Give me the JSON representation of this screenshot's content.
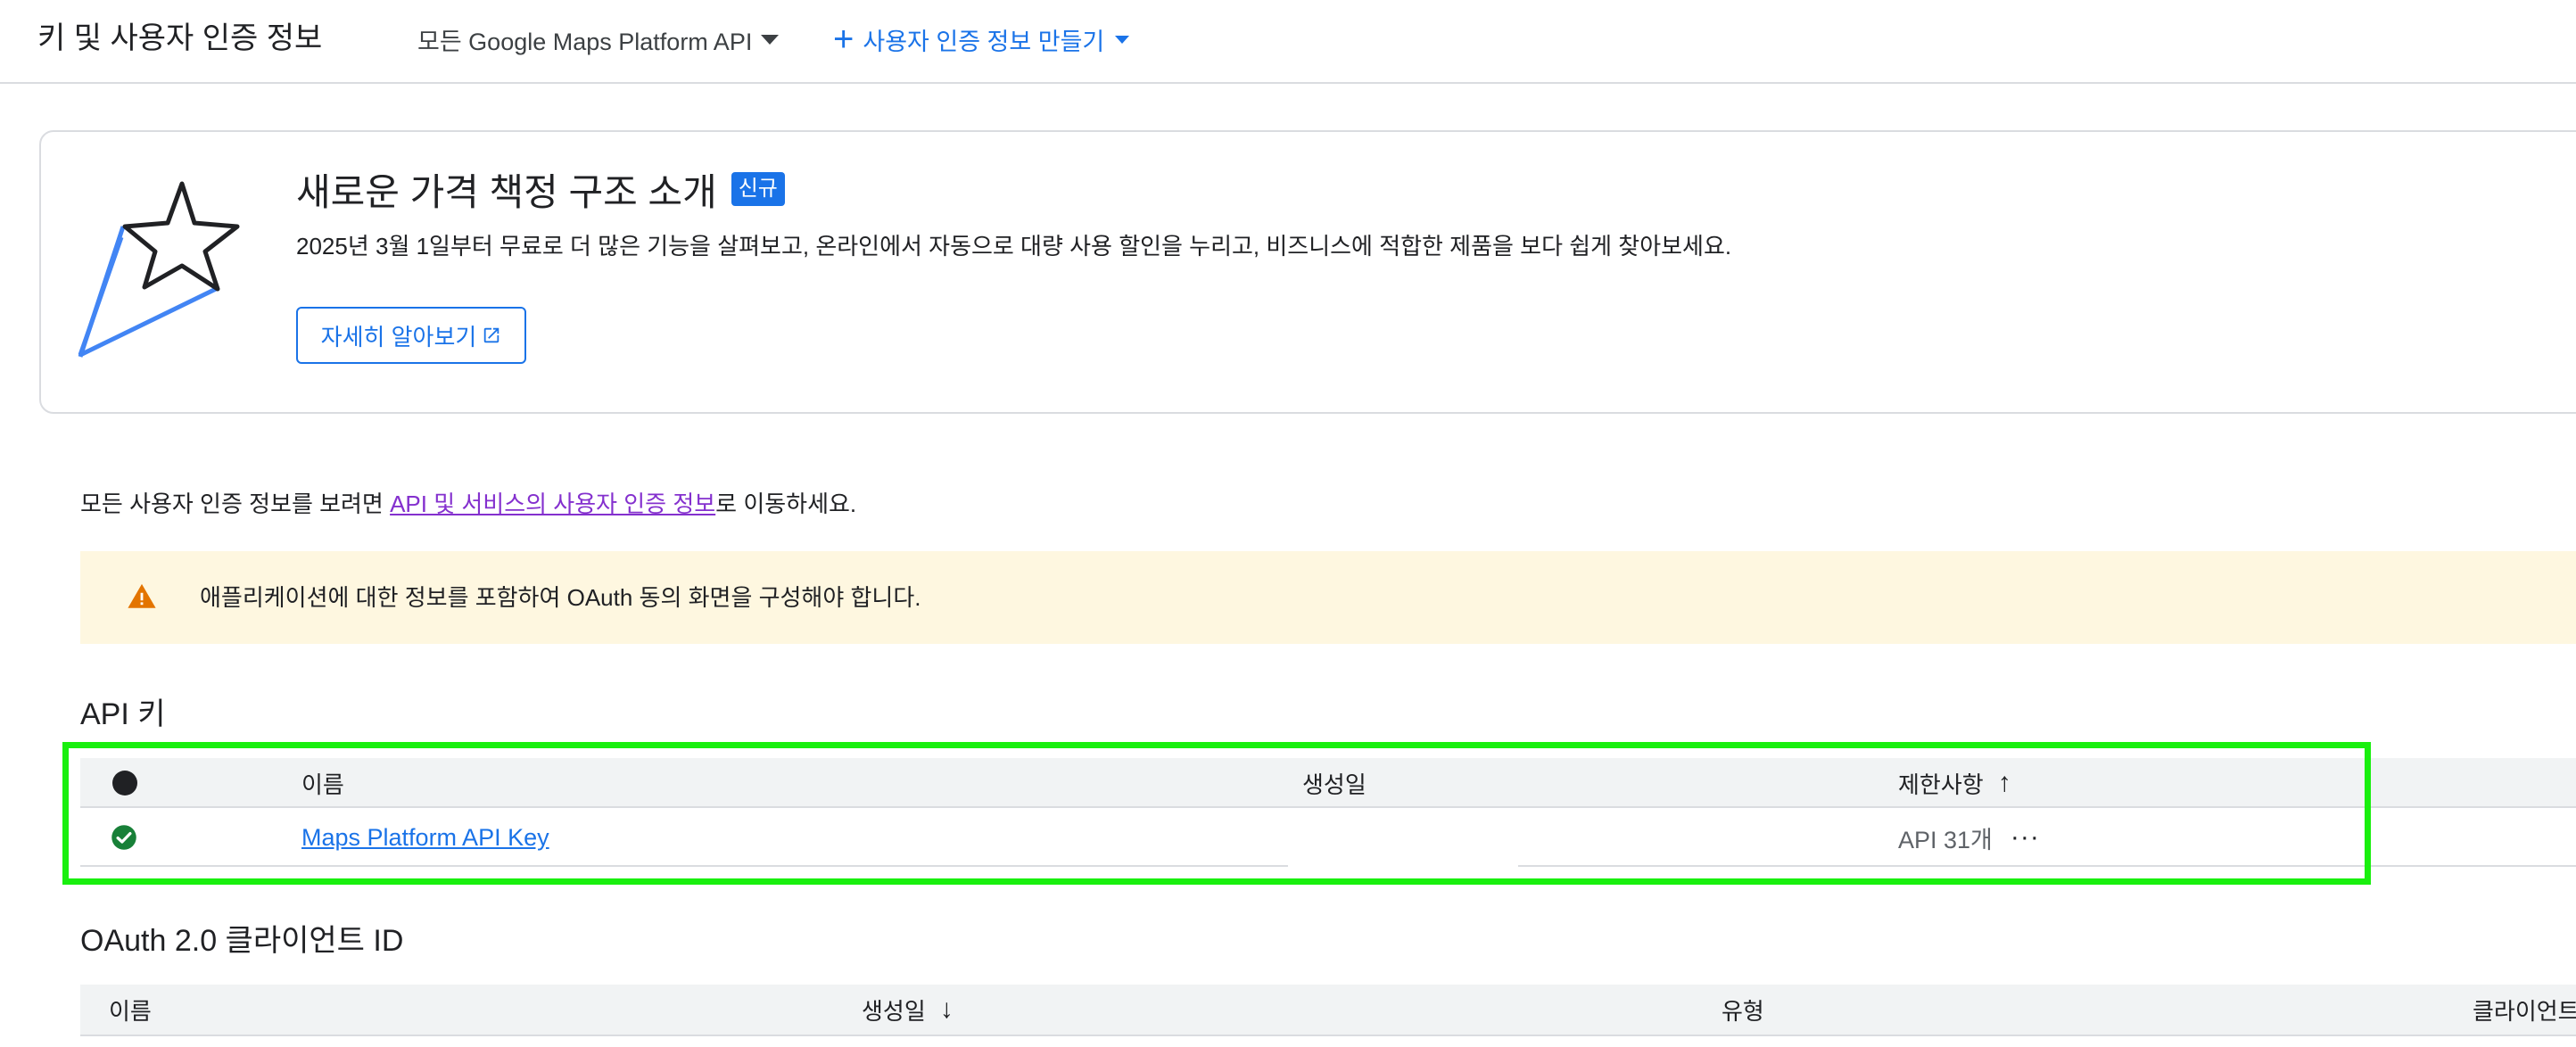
{
  "header": {
    "title": "키 및 사용자 인증 정보",
    "api_filter": "모든 Google Maps Platform API",
    "create_credentials": "사용자 인증 정보 만들기"
  },
  "promo": {
    "title": "새로운 가격 책정 구조 소개",
    "badge": "신규",
    "description": "2025년 3월 1일부터 무료로 더 많은 기능을 살펴보고, 온라인에서 자동으로 대량 사용 할인을 누리고, 비즈니스에 적합한 제품을 보다 쉽게 찾아보세요.",
    "learn_more": "자세히 알아보기"
  },
  "info": {
    "prefix": "모든 사용자 인증 정보를 보려면 ",
    "link": "API 및 서비스의 사용자 인증 정보",
    "suffix": "로 이동하세요."
  },
  "warning": {
    "text": "애플리케이션에 대한 정보를 포함하여 OAuth 동의 화면을 구성해야 합니다."
  },
  "api_keys": {
    "title": "API 키",
    "columns": {
      "name": "이름",
      "created": "생성일",
      "restrictions": "제한사항"
    },
    "rows": [
      {
        "name": "Maps Platform API Key",
        "created": "",
        "restrictions": "API 31개"
      }
    ]
  },
  "oauth": {
    "title": "OAuth 2.0 클라이언트 ID",
    "columns": {
      "name": "이름",
      "created": "생성일",
      "type": "유형",
      "client_id": "클라이언트 ID"
    }
  },
  "colors": {
    "accent": "#1a73e8",
    "visited_link": "#8430ce",
    "warning_bg": "#fef7e0",
    "warning_icon": "#e37400",
    "success": "#188038",
    "highlight": "#19ef0e"
  }
}
